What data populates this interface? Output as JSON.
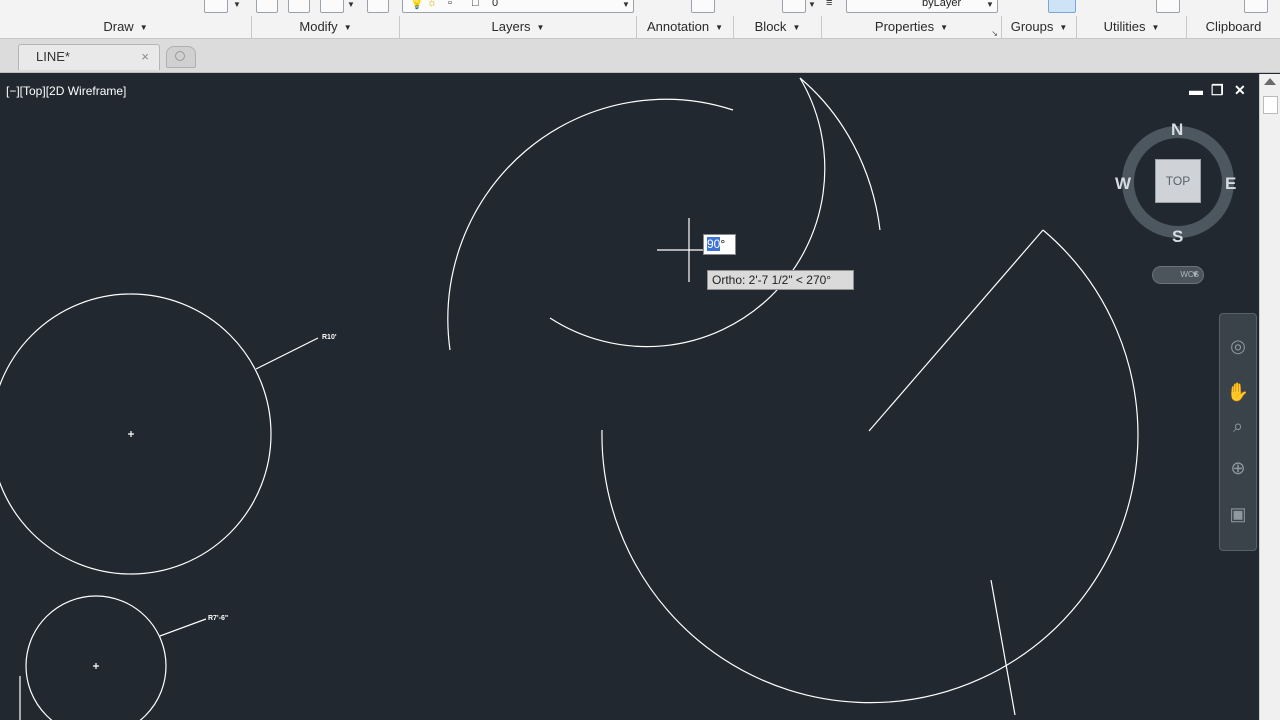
{
  "ribbon": {
    "panels": [
      {
        "label": "Draw"
      },
      {
        "label": "Modify"
      },
      {
        "label": "Layers"
      },
      {
        "label": "Annotation"
      },
      {
        "label": "Block"
      },
      {
        "label": "Properties"
      },
      {
        "label": "Groups"
      },
      {
        "label": "Utilities"
      },
      {
        "label": "Clipboard"
      }
    ],
    "layer_value": "0",
    "linetype_value": "byLayer"
  },
  "tabs": {
    "active": {
      "label": "LINE*",
      "close": "×"
    }
  },
  "viewport": {
    "label": "[−][Top][2D Wireframe]",
    "controls": {
      "minimize": "▬",
      "restore": "❐",
      "close": "✕"
    }
  },
  "viewcube": {
    "top_label": "TOP",
    "north": "N",
    "south": "S",
    "east": "E",
    "west": "W",
    "wcs_label": "WCS"
  },
  "drawing": {
    "dynamic_input": "90",
    "degree_suffix": "°",
    "ortho_tooltip": "Ortho: 2'-7 1/2\" < 270°",
    "labels": {
      "r1": "R10'",
      "r2": "R7'-6\""
    }
  },
  "colors": {
    "canvas": "#212830",
    "geometry": "#ffffff",
    "selection": "#3c73d6"
  }
}
